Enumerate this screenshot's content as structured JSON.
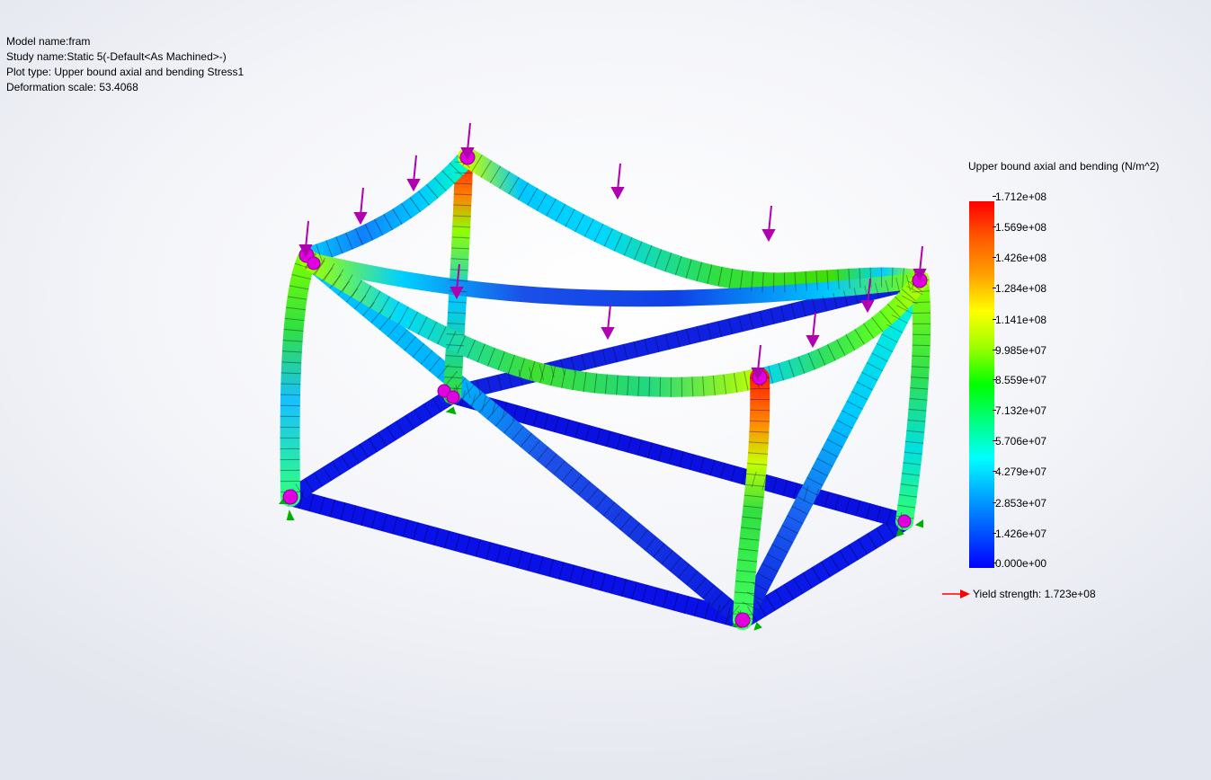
{
  "info": {
    "model_name": "Model name:fram",
    "study_name": "Study name:Static 5(-Default<As Machined>-)",
    "plot_type": "Plot type: Upper bound axial and bending Stress1",
    "deformation_scale": "Deformation scale: 53.4068"
  },
  "legend": {
    "title": "Upper bound axial and bending (N/m^2)",
    "ticks": [
      "1.712e+08",
      "1.569e+08",
      "1.426e+08",
      "1.284e+08",
      "1.141e+08",
      "9.985e+07",
      "8.559e+07",
      "7.132e+07",
      "5.706e+07",
      "4.279e+07",
      "2.853e+07",
      "1.426e+07",
      "0.000e+00"
    ],
    "yield_label": "Yield strength: 1.723e+08",
    "max_value": 171200000.0,
    "min_value": 0,
    "yield_value": 172300000.0
  },
  "colors": {
    "low": "#0000ff",
    "mid": "#00ff00",
    "high": "#ff0000",
    "joint": "#e000e0",
    "load_arrow": "#b000b0",
    "fixture": "#00b000",
    "yield_arrow": "#ff0000"
  },
  "icons": {
    "load": "load-arrow-icon",
    "fixture": "fixed-support-icon",
    "joint": "joint-icon"
  }
}
